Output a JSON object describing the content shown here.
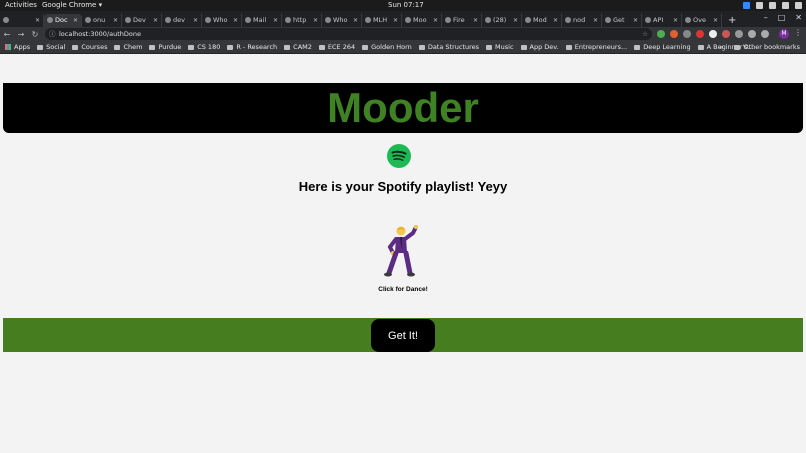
{
  "system_bar": {
    "activities": "Activities",
    "app_name": "Google Chrome ▾",
    "clock": "Sun 07:17"
  },
  "tabs": [
    {
      "label": ""
    },
    {
      "label": "Doc"
    },
    {
      "label": "onu"
    },
    {
      "label": "Dev"
    },
    {
      "label": "dev"
    },
    {
      "label": "Who"
    },
    {
      "label": "Mail"
    },
    {
      "label": "http"
    },
    {
      "label": "Who"
    },
    {
      "label": "MLH"
    },
    {
      "label": "Moo"
    },
    {
      "label": "Fire"
    },
    {
      "label": "(28)"
    },
    {
      "label": "Mod"
    },
    {
      "label": "nod"
    },
    {
      "label": "Get"
    },
    {
      "label": "API"
    },
    {
      "label": "Ove"
    }
  ],
  "toolbar": {
    "url": "localhost:3000/authDone",
    "avatar_letter": "M"
  },
  "bookmarks": [
    {
      "label": "Apps",
      "icon": "apps-grid-icon"
    },
    {
      "label": "Social",
      "icon": "folder-icon"
    },
    {
      "label": "Courses",
      "icon": "folder-icon"
    },
    {
      "label": "Chem",
      "icon": "folder-icon"
    },
    {
      "label": "Purdue",
      "icon": "folder-icon"
    },
    {
      "label": "CS 180",
      "icon": "folder-icon"
    },
    {
      "label": "R - Research",
      "icon": "folder-icon"
    },
    {
      "label": "CAM2",
      "icon": "folder-icon"
    },
    {
      "label": "ECE 264",
      "icon": "folder-icon"
    },
    {
      "label": "Golden Horn",
      "icon": "folder-icon"
    },
    {
      "label": "Data Structures",
      "icon": "folder-icon"
    },
    {
      "label": "Music",
      "icon": "folder-icon"
    },
    {
      "label": "App Dev.",
      "icon": "folder-icon"
    },
    {
      "label": "Entrepreneurs...",
      "icon": "folder-icon"
    },
    {
      "label": "Deep Learning",
      "icon": "folder-icon"
    },
    {
      "label": "A Beginner's...",
      "icon": "page-icon"
    }
  ],
  "bookmarks_more": "»",
  "other_bookmarks": "Other bookmarks",
  "page": {
    "title": "Mooder",
    "subtitle": "Here is your Spotify playlist! Yeyy",
    "dance_caption": "Click for Dance!",
    "button_label": "Get It!"
  },
  "colors": {
    "title_green": "#3f8224",
    "bar_green": "#467d1e",
    "spotify_green": "#1db954"
  }
}
